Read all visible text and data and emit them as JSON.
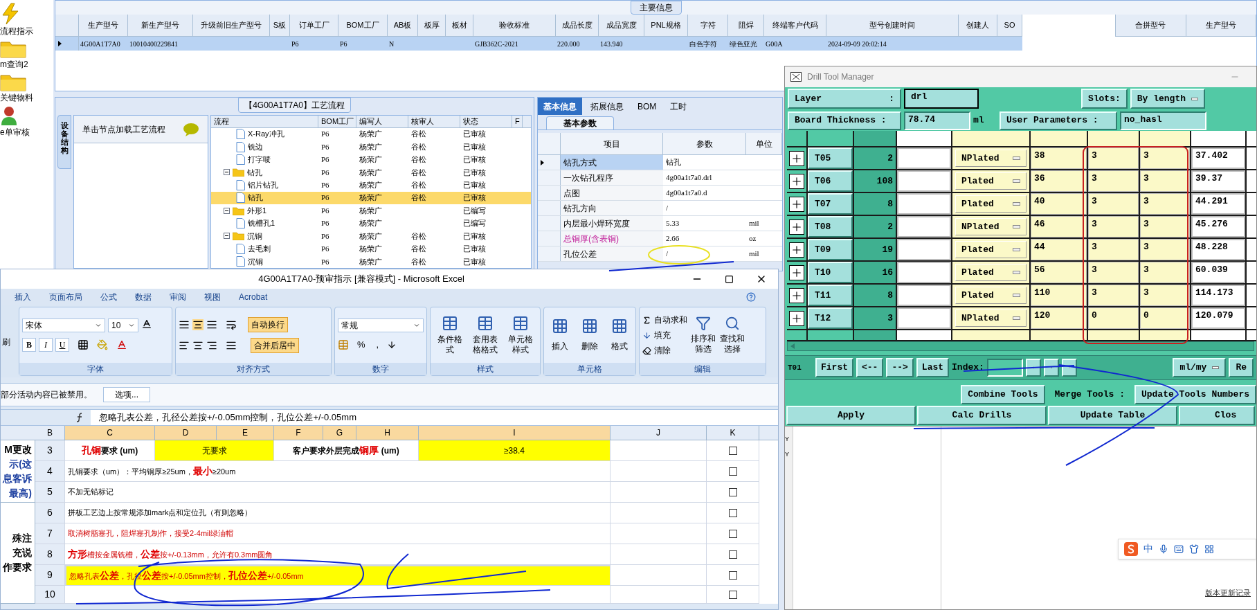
{
  "sidebar": {
    "items": [
      {
        "kind": "flash",
        "label": "流程指示"
      },
      {
        "kind": "folder",
        "label": "m查询2"
      },
      {
        "kind": "folder",
        "label": "关键物料"
      },
      {
        "kind": "user",
        "label": "e单审核"
      }
    ]
  },
  "main_info": {
    "title": "主要信息",
    "columns": [
      "生产型号",
      "新生产型号",
      "升级前旧生产型号",
      "S板",
      "订单工厂",
      "BOM工厂",
      "AB板",
      "板厚",
      "板材",
      "验收标准",
      "成品长度",
      "成品宽度",
      "PNL规格",
      "字符",
      "阻焊",
      "终端客户代码",
      "型号创建时间",
      "创建人",
      "SO"
    ],
    "rows": [
      {
        "selected": true,
        "cells": [
          "4G00A1T7A0",
          "10010400229841",
          null,
          null,
          "P6",
          "P6",
          "N",
          null,
          null,
          "GJB362C-2021",
          "220.000",
          "143.940",
          null,
          "白色字符",
          "绿色亚光",
          "G00A",
          "2024-09-09 20:02:14",
          null,
          null
        ]
      }
    ],
    "merge_columns": [
      "合拼型号",
      "生产型号"
    ]
  },
  "process_flow": {
    "title": "【4G00A1T7A0】工艺流程",
    "side_tab": "设备结构",
    "hint": "单击节点加载工艺流程",
    "columns": [
      "流程",
      "BOM工厂",
      "编写人",
      "核审人",
      "状态",
      "F"
    ],
    "nodes": [
      {
        "kind": "continuation",
        "children": [
          {
            "kind": "step",
            "name": "X-Ray冲孔",
            "factory": "P6",
            "writer": "杨荣广",
            "reviewer": "谷松",
            "status": "已审核",
            "selected": false
          },
          {
            "kind": "step",
            "name": "铣边",
            "factory": "P6",
            "writer": "杨荣广",
            "reviewer": "谷松",
            "status": "已审核",
            "selected": false
          },
          {
            "kind": "step",
            "name": "打字唛",
            "factory": "P6",
            "writer": "杨荣广",
            "reviewer": "谷松",
            "status": "已审核",
            "selected": false
          }
        ]
      },
      {
        "kind": "group",
        "name": "钻孔",
        "expanded": true,
        "factory": "P6",
        "writer": "杨荣广",
        "reviewer": "谷松",
        "status": "已审核",
        "selected": false,
        "children": [
          {
            "kind": "step",
            "name": "铝片钻孔",
            "factory": "P6",
            "writer": "杨荣广",
            "reviewer": "谷松",
            "status": "已审核",
            "selected": false
          },
          {
            "kind": "step",
            "name": "钻孔",
            "factory": "P6",
            "writer": "杨荣广",
            "reviewer": "谷松",
            "status": "已审核",
            "selected": true
          }
        ]
      },
      {
        "kind": "group",
        "name": "外形1",
        "expanded": true,
        "factory": "P6",
        "writer": "杨荣广",
        "status": "已编写",
        "selected": false,
        "children": [
          {
            "kind": "step",
            "name": "铣槽孔1",
            "factory": "P6",
            "writer": "杨荣广",
            "status": "已编写",
            "selected": false
          }
        ]
      },
      {
        "kind": "group",
        "name": "沉铜",
        "expanded": true,
        "factory": "P6",
        "writer": "杨荣广",
        "reviewer": "谷松",
        "status": "已审核",
        "selected": false,
        "children": [
          {
            "kind": "step",
            "name": "去毛刺",
            "factory": "P6",
            "writer": "杨荣广",
            "reviewer": "谷松",
            "status": "已审核",
            "selected": false
          },
          {
            "kind": "step",
            "name": "沉铜",
            "factory": "P6",
            "writer": "杨荣广",
            "reviewer": "谷松",
            "status": "已审核",
            "selected": false
          }
        ]
      }
    ]
  },
  "params": {
    "tabs": [
      {
        "label": "基本信息",
        "selected": true
      },
      {
        "label": "拓展信息",
        "selected": false
      },
      {
        "label": "BOM",
        "selected": false
      },
      {
        "label": "工时",
        "selected": false
      }
    ],
    "subtab": "基本参数",
    "columns": [
      "项目",
      "参数",
      "单位"
    ],
    "rows": [
      {
        "item": "钻孔方式",
        "value": "钻孔",
        "selected": true,
        "flagged": false
      },
      {
        "item": "一次钻孔程序",
        "value": "4g00a1t7a0.drl",
        "selected": false,
        "flagged": false
      },
      {
        "item": "点图",
        "value": "4g00a1t7a0.d",
        "selected": false,
        "flagged": false
      },
      {
        "item": "钻孔方向",
        "value": "/",
        "selected": false,
        "flagged": false
      },
      {
        "item": "内层最小焊环宽度",
        "value": "5.33",
        "unit": "mil",
        "selected": false,
        "flagged": false
      },
      {
        "item": "总铜厚(含表铜)",
        "value": "2.66",
        "unit": "oz",
        "selected": false,
        "flagged": true
      },
      {
        "item": "孔位公差",
        "value": "/",
        "unit": "mil",
        "selected": false,
        "flagged": false
      }
    ]
  },
  "excel": {
    "title": "4G00A1T7A0-预审指示  [兼容模式] - Microsoft Excel",
    "tabs": [
      "插入",
      "页面布局",
      "公式",
      "数据",
      "审阅",
      "视图",
      "Acrobat"
    ],
    "clipboard_cut": "刷",
    "font": {
      "name": "宋体",
      "size": "10",
      "style_buttons": [
        "B",
        "I",
        "U"
      ],
      "group": "字体"
    },
    "alignment": {
      "toggles": [
        {
          "label": "自动换行",
          "on": true
        },
        {
          "label": "合并后居中",
          "on": true
        }
      ],
      "group": "对齐方式"
    },
    "number": {
      "format": "常规",
      "symbols": [
        "%",
        ","
      ],
      "group": "数字"
    },
    "styles": {
      "buttons": [
        "条件格式",
        "套用表格格式",
        "单元格样式"
      ],
      "group": "样式"
    },
    "cells": {
      "buttons": [
        "插入",
        "删除",
        "格式"
      ],
      "group": "单元格"
    },
    "editing": {
      "small": [
        "自动求和",
        "填充",
        "清除"
      ],
      "large": [
        "排序和筛选",
        "查找和选择"
      ],
      "group": "编辑"
    },
    "security": {
      "message": "部分活动内容已被禁用。",
      "button": "选项..."
    },
    "formula": "忽略孔表公差，孔径公差按+/-0.05mm控制，孔位公差+/-0.05mm",
    "columns": [
      {
        "label": "B",
        "selected": false
      },
      {
        "label": "C",
        "selected": true
      },
      {
        "label": "D",
        "selected": true
      },
      {
        "label": "E",
        "selected": true
      },
      {
        "label": "F",
        "selected": true
      },
      {
        "label": "G",
        "selected": true
      },
      {
        "label": "H",
        "selected": true
      },
      {
        "label": "I",
        "selected": true
      },
      {
        "label": "J",
        "selected": false
      },
      {
        "label": "K",
        "selected": false
      }
    ],
    "sections": [
      {
        "note_lines": [
          {
            "text": "M更改",
            "accent": false
          },
          {
            "text": "示(这",
            "accent": true
          },
          {
            "text": "息客诉",
            "accent": true
          },
          {
            "text": "最高)",
            "accent": true
          }
        ],
        "rows": [
          {
            "number": "3",
            "kind": "pair",
            "filled": true,
            "checked": false,
            "label": [
              {
                "text": "孔铜",
                "emphasis": true
              },
              {
                "text": "要求 (um)"
              }
            ],
            "value": "无要求",
            "label2": [
              {
                "text": "客户要求外层完成"
              },
              {
                "text": "铜厚",
                "emphasis": true
              },
              {
                "text": " (um)"
              }
            ],
            "value2": "≥38.4"
          },
          {
            "number": "4",
            "kind": "wide",
            "filled": false,
            "alert": false,
            "checked": false,
            "parts": [
              {
                "text": "孔铜要求（um）：平均铜厚≥25um，"
              },
              {
                "text": "最小",
                "emphasis": true
              },
              {
                "text": "≥20um"
              }
            ]
          },
          {
            "number": "5",
            "kind": "wide",
            "filled": false,
            "alert": false,
            "checked": false,
            "parts": [
              {
                "text": "不加无铅标记"
              }
            ]
          }
        ]
      },
      {
        "note_lines": [
          {
            "text": "殊注",
            "accent": false
          },
          {
            "text": "充说",
            "accent": false
          },
          {
            "text": "作要求",
            "accent": false
          }
        ],
        "rows": [
          {
            "number": "6",
            "kind": "wide",
            "filled": false,
            "alert": false,
            "checked": false,
            "parts": [
              {
                "text": "拼板工艺边上按常规添加mark点和定位孔（有则忽略）"
              }
            ]
          },
          {
            "number": "7",
            "kind": "wide",
            "filled": false,
            "alert": true,
            "checked": false,
            "parts": [
              {
                "text": "取消树脂塞孔，阻焊塞孔制作，接受2-4mil绿油帽"
              }
            ]
          },
          {
            "number": "8",
            "kind": "wide",
            "filled": false,
            "alert": true,
            "checked": false,
            "parts": [
              {
                "text": "方形",
                "emphasis": true
              },
              {
                "text": "槽按金属铣槽，"
              },
              {
                "text": "公差",
                "emphasis": true
              },
              {
                "text": "按+/-0.13mm，允许有0.3mm圆角"
              }
            ]
          },
          {
            "number": "9",
            "kind": "wide",
            "filled": true,
            "alert": true,
            "checked": false,
            "parts": [
              {
                "text": "忽略孔表"
              },
              {
                "text": "公差",
                "emphasis": true
              },
              {
                "text": "，孔径"
              },
              {
                "text": "公差",
                "emphasis": true
              },
              {
                "text": "按+/-0.05mm控制，"
              },
              {
                "text": "孔位公差",
                "emphasis": true
              },
              {
                "text": "+/-0.05mm"
              }
            ]
          },
          {
            "number": "10",
            "kind": "wide",
            "filled": false,
            "checked": false
          }
        ]
      }
    ]
  },
  "drill": {
    "title": "Drill Tool Manager",
    "layer": {
      "label": "Layer",
      "separator": ":",
      "value": "drl"
    },
    "slots": {
      "label": "Slots:",
      "value": "By length"
    },
    "board_thickness": {
      "label": "Board Thickness :",
      "value": "78.74",
      "unit": "ml"
    },
    "user_parameters": {
      "label": "User Parameters :",
      "value": "no_hasl"
    },
    "tools": [
      {
        "name": "T05",
        "count": "2",
        "type": "NPlated",
        "c1": "38",
        "c2": "3",
        "c3": "3",
        "size": "37.402"
      },
      {
        "name": "T06",
        "count": "108",
        "type": "Plated",
        "c1": "36",
        "c2": "3",
        "c3": "3",
        "size": "39.37"
      },
      {
        "name": "T07",
        "count": "8",
        "type": "Plated",
        "c1": "40",
        "c2": "3",
        "c3": "3",
        "size": "44.291"
      },
      {
        "name": "T08",
        "count": "2",
        "type": "NPlated",
        "c1": "46",
        "c2": "3",
        "c3": "3",
        "size": "45.276"
      },
      {
        "name": "T09",
        "count": "19",
        "type": "Plated",
        "c1": "44",
        "c2": "3",
        "c3": "3",
        "size": "48.228"
      },
      {
        "name": "T10",
        "count": "16",
        "type": "Plated",
        "c1": "56",
        "c2": "3",
        "c3": "3",
        "size": "60.039"
      },
      {
        "name": "T11",
        "count": "8",
        "type": "Plated",
        "c1": "110",
        "c2": "3",
        "c3": "3",
        "size": "114.173"
      },
      {
        "name": "T12",
        "count": "3",
        "type": "NPlated",
        "c1": "120",
        "c2": "0",
        "c3": "0",
        "size": "120.079"
      }
    ],
    "current_tool": "T01",
    "nav_buttons": [
      "First",
      "<--",
      "-->",
      "Last"
    ],
    "index_label": "Index:",
    "units": "ml/my",
    "edge_button": "Re",
    "actions_row1": [
      {
        "kind": "button",
        "label": "Combine Tools"
      },
      {
        "kind": "label",
        "label": "Merge Tools :"
      },
      {
        "kind": "button",
        "label": "Update Tools Numbers"
      }
    ],
    "actions_row2": [
      "Apply",
      "Calc Drills",
      "Update Table",
      "Clos"
    ],
    "list_marks": [
      "Y",
      "Y"
    ]
  },
  "ime": {
    "mode": "中"
  },
  "footer_link": "版本更新记录"
}
